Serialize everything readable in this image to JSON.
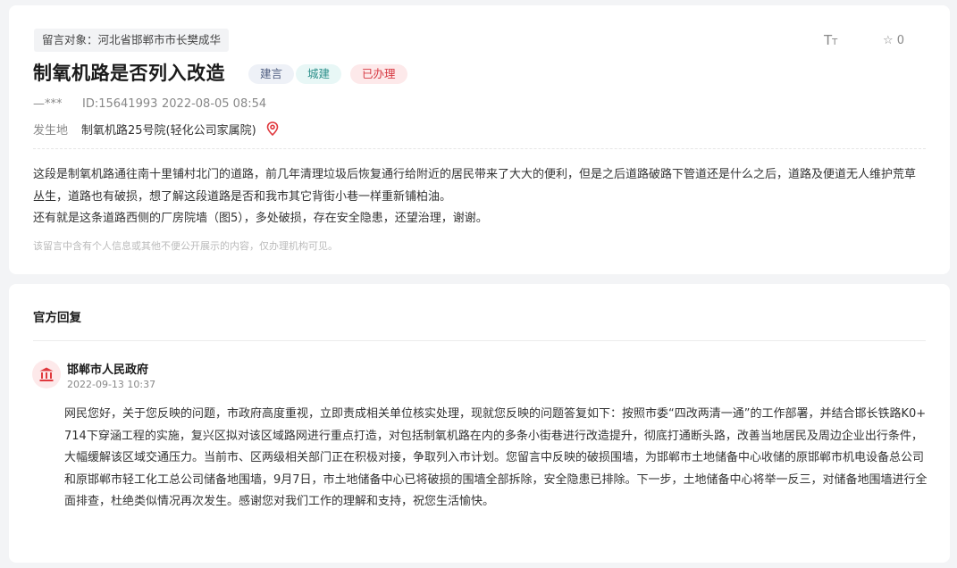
{
  "message": {
    "target_label": "留言对象：河北省邯郸市市长樊成华",
    "title": "制氧机路是否列入改造",
    "tags": {
      "type": "建言",
      "category": "城建",
      "status": "已办理"
    },
    "tools": {
      "font_size_icon": "font-size-icon",
      "like_count": "0"
    },
    "author": "—***",
    "id": "ID:15641993",
    "date": "2022-08-05 08:54",
    "location_label": "发生地",
    "location_value": "制氧机路25号院(轻化公司家属院)",
    "content": [
      "这段是制氧机路通往南十里铺村北门的道路，前几年清理垃圾后恢复通行给附近的居民带来了大大的便利，但是之后道路破路下管道还是什么之后，道路及便道无人维护荒草丛生，道路也有破损，想了解这段道路是否和我市其它背街小巷一样重新铺柏油。",
      "还有就是这条道路西侧的厂房院墙（图5），多处破损，存在安全隐患，还望治理，谢谢。"
    ],
    "privacy_note": "该留言中含有个人信息或其他不便公开展示的内容，仅办理机构可见。"
  },
  "reply": {
    "section_title": "官方回复",
    "org_name": "邯郸市人民政府",
    "date": "2022-09-13 10:37",
    "body": "网民您好，关于您反映的问题，市政府高度重视，立即责成相关单位核实处理，现就您反映的问题答复如下：按照市委“四改两清一通”的工作部署，并结合邯长铁路K0+714下穿涵工程的实施，复兴区拟对该区域路网进行重点打造，对包括制氧机路在内的多条小街巷进行改造提升，彻底打通断头路，改善当地居民及周边企业出行条件，大幅缓解该区域交通压力。当前市、区两级相关部门正在积极对接，争取列入市计划。您留言中反映的破损围墙，为邯郸市土地储备中心收储的原邯郸市机电设备总公司和原邯郸市轻工化工总公司储备地围墙，9月7日，市土地储备中心已将破损的围墙全部拆除，安全隐患已排除。下一步，土地储备中心将举一反三，对储备地围墙进行全面排查，杜绝类似情况再次发生。感谢您对我们工作的理解和支持，祝您生活愉快。"
  },
  "colors": {
    "page_bg": "#f3f4f6",
    "status_red": "#d63a43",
    "category_teal": "#2c8f8a",
    "type_slate": "#4e5d80",
    "icon_pink_bg": "#fde9ea"
  }
}
